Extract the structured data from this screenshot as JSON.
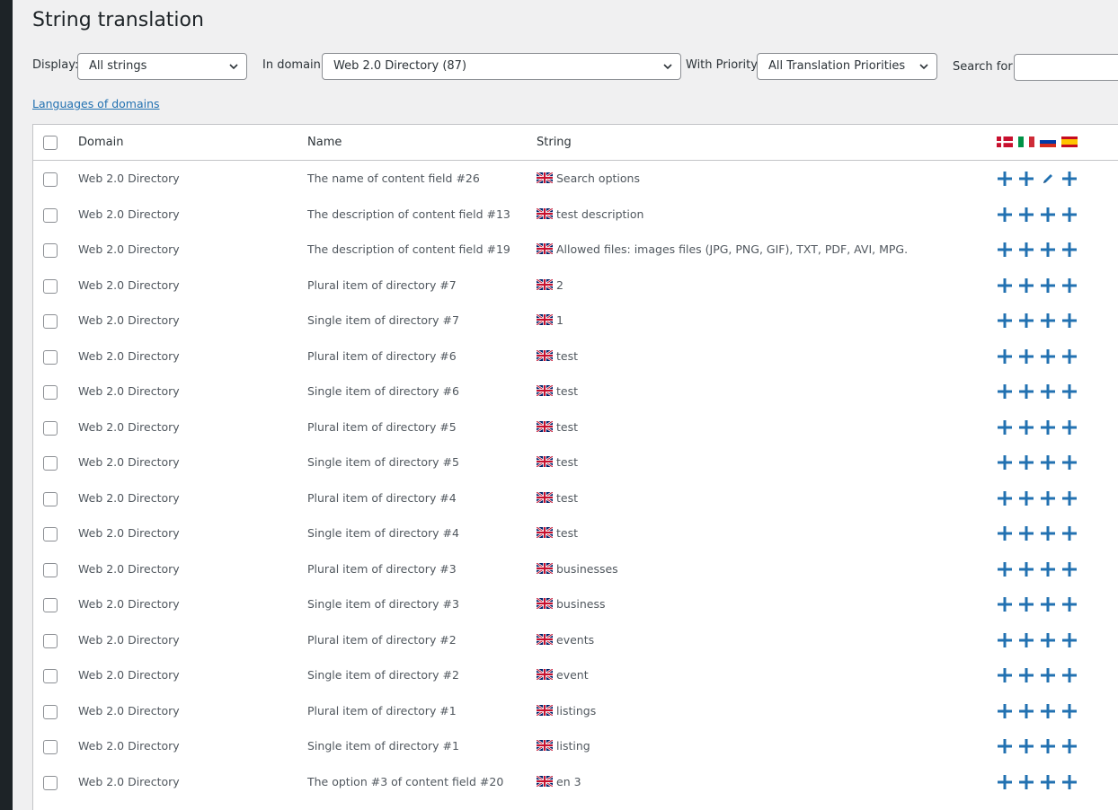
{
  "page": {
    "title": "String translation"
  },
  "filters": {
    "display_label": "Display:",
    "display_value": "All strings",
    "domain_label": "In domain:",
    "domain_value": "Web 2.0 Directory (87)",
    "priority_label": "With Priority:",
    "priority_value": "All Translation Priorities",
    "search_label": "Search for:",
    "search_value": ""
  },
  "links": {
    "languages_of_domains": "Languages of domains"
  },
  "table": {
    "headers": {
      "domain": "Domain",
      "name": "Name",
      "string": "String"
    },
    "header_flags": [
      "flag-dk-icon",
      "flag-it-icon",
      "flag-ru-icon",
      "flag-es-icon"
    ],
    "rows": [
      {
        "domain": "Web 2.0 Directory",
        "name": "The name of content field #26",
        "string": "Search options",
        "actions": [
          "add",
          "add",
          "edit",
          "add"
        ]
      },
      {
        "domain": "Web 2.0 Directory",
        "name": "The description of content field #13",
        "string": "test description",
        "actions": [
          "add",
          "add",
          "add",
          "add"
        ]
      },
      {
        "domain": "Web 2.0 Directory",
        "name": "The description of content field #19",
        "string": "Allowed files: images files (JPG, PNG, GIF), TXT, PDF, AVI, MPG.",
        "actions": [
          "add",
          "add",
          "add",
          "add"
        ]
      },
      {
        "domain": "Web 2.0 Directory",
        "name": "Plural item of directory #7",
        "string": "2",
        "actions": [
          "add",
          "add",
          "add",
          "add"
        ]
      },
      {
        "domain": "Web 2.0 Directory",
        "name": "Single item of directory #7",
        "string": "1",
        "actions": [
          "add",
          "add",
          "add",
          "add"
        ]
      },
      {
        "domain": "Web 2.0 Directory",
        "name": "Plural item of directory #6",
        "string": "test",
        "actions": [
          "add",
          "add",
          "add",
          "add"
        ]
      },
      {
        "domain": "Web 2.0 Directory",
        "name": "Single item of directory #6",
        "string": "test",
        "actions": [
          "add",
          "add",
          "add",
          "add"
        ]
      },
      {
        "domain": "Web 2.0 Directory",
        "name": "Plural item of directory #5",
        "string": "test",
        "actions": [
          "add",
          "add",
          "add",
          "add"
        ]
      },
      {
        "domain": "Web 2.0 Directory",
        "name": "Single item of directory #5",
        "string": "test",
        "actions": [
          "add",
          "add",
          "add",
          "add"
        ]
      },
      {
        "domain": "Web 2.0 Directory",
        "name": "Plural item of directory #4",
        "string": "test",
        "actions": [
          "add",
          "add",
          "add",
          "add"
        ]
      },
      {
        "domain": "Web 2.0 Directory",
        "name": "Single item of directory #4",
        "string": "test",
        "actions": [
          "add",
          "add",
          "add",
          "add"
        ]
      },
      {
        "domain": "Web 2.0 Directory",
        "name": "Plural item of directory #3",
        "string": "businesses",
        "actions": [
          "add",
          "add",
          "add",
          "add"
        ]
      },
      {
        "domain": "Web 2.0 Directory",
        "name": "Single item of directory #3",
        "string": "business",
        "actions": [
          "add",
          "add",
          "add",
          "add"
        ]
      },
      {
        "domain": "Web 2.0 Directory",
        "name": "Plural item of directory #2",
        "string": "events",
        "actions": [
          "add",
          "add",
          "add",
          "add"
        ]
      },
      {
        "domain": "Web 2.0 Directory",
        "name": "Single item of directory #2",
        "string": "event",
        "actions": [
          "add",
          "add",
          "add",
          "add"
        ]
      },
      {
        "domain": "Web 2.0 Directory",
        "name": "Plural item of directory #1",
        "string": "listings",
        "actions": [
          "add",
          "add",
          "add",
          "add"
        ]
      },
      {
        "domain": "Web 2.0 Directory",
        "name": "Single item of directory #1",
        "string": "listing",
        "actions": [
          "add",
          "add",
          "add",
          "add"
        ]
      },
      {
        "domain": "Web 2.0 Directory",
        "name": "The option #3 of content field #20",
        "string": "en 3",
        "actions": [
          "add",
          "add",
          "add",
          "add"
        ]
      }
    ]
  },
  "colors": {
    "accent": "#2271b1",
    "admin_bar": "#1d2327",
    "background": "#f0f0f1"
  }
}
